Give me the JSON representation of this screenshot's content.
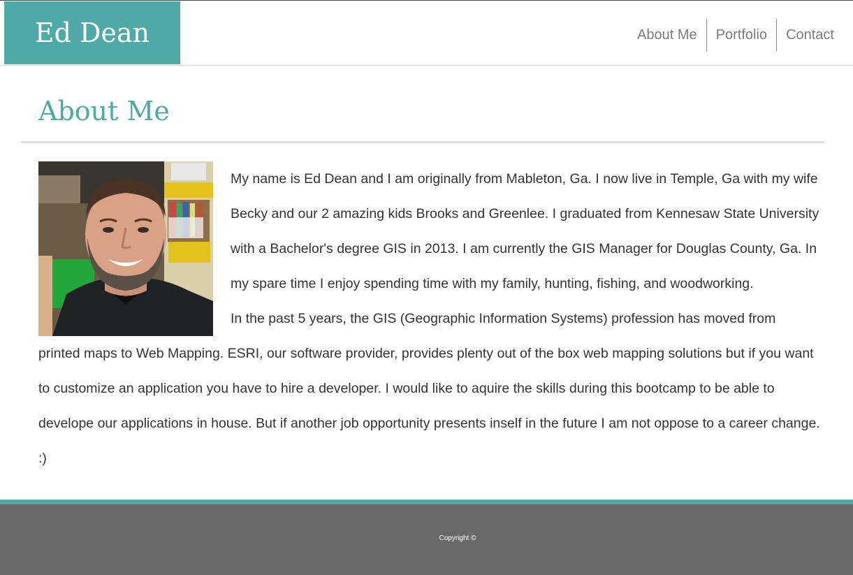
{
  "header": {
    "brand": "Ed Dean",
    "nav": [
      {
        "label": "About Me"
      },
      {
        "label": "Portfolio"
      },
      {
        "label": "Contact"
      }
    ]
  },
  "main": {
    "title": "About Me",
    "photo_alt": "portrait-photo",
    "paragraphs": [
      "My name is Ed Dean and I am originally from Mableton, Ga. I now live in Temple, Ga with my wife Becky and our 2 amazing kids Brooks and Greenlee. I graduated from Kennesaw State University with a Bachelor's degree GIS in 2013. I am currently the GIS Manager for Douglas County, Ga. In my spare time I enjoy spending time with my family, hunting, fishing, and woodworking.",
      "In the past 5 years, the GIS (Geographic Information Systems) profession has moved from printed maps to Web Mapping. ESRI, our software provider, provides plenty out of the box web mapping solutions but if you want to customize an application you have to hire a developer. I would like to aquire the skills during this bootcamp to be able to develope our applications in house. But if another job opportunity presents inself in the future I am not oppose to a career change. :)"
    ]
  },
  "footer": {
    "copyright": "Copyright ©"
  },
  "colors": {
    "accent": "#4fa9a6",
    "footer_bg": "#696969",
    "nav_text": "#7b7b7b",
    "body_text": "#333333"
  }
}
